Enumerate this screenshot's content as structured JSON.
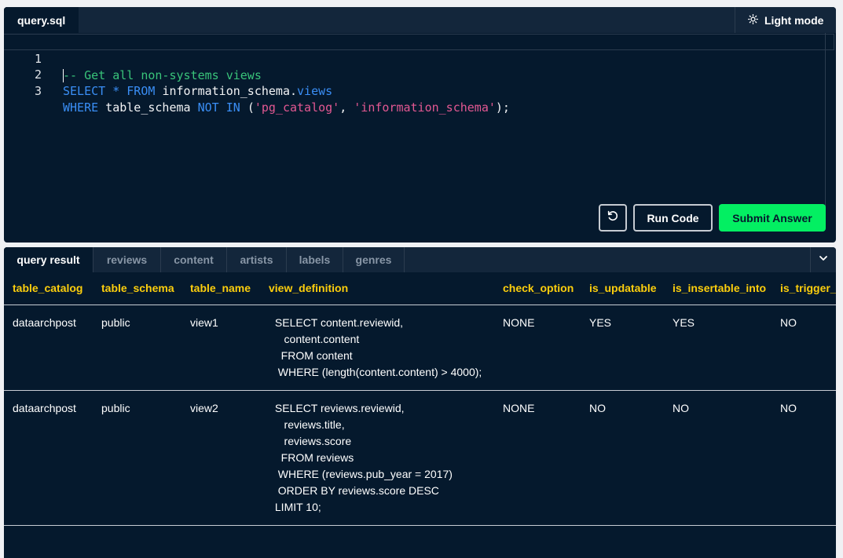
{
  "editor": {
    "file_tab": "query.sql",
    "mode_toggle_label": "Light mode",
    "line_numbers": [
      "1",
      "2",
      "3"
    ],
    "line1": {
      "comment": "-- Get all non-systems views"
    },
    "line2": {
      "kw_select": "SELECT",
      "op_star": "*",
      "kw_from": "FROM",
      "schema": "information_schema.",
      "view_prop": "views"
    },
    "line3": {
      "kw_where": "WHERE",
      "column": "table_schema",
      "kw_not": "NOT",
      "kw_in": "IN",
      "open_paren": "(",
      "str1": "'pg_catalog'",
      "comma": ",",
      "str2": "'information_schema'",
      "close": ");"
    },
    "buttons": {
      "reset_icon": "reset-icon",
      "run_label": "Run Code",
      "submit_label": "Submit Answer"
    }
  },
  "results": {
    "tabs": [
      "query result",
      "reviews",
      "content",
      "artists",
      "labels",
      "genres"
    ],
    "active_tab": "query result",
    "columns": [
      "table_catalog",
      "table_schema",
      "table_name",
      "view_definition",
      "check_option",
      "is_updatable",
      "is_insertable_into",
      "is_trigger_"
    ],
    "rows": [
      [
        "dataarchpost",
        "public",
        "view1",
        " SELECT content.reviewid,\n    content.content\n   FROM content\n  WHERE (length(content.content) > 4000);",
        "NONE",
        "YES",
        "YES",
        "NO"
      ],
      [
        "dataarchpost",
        "public",
        "view2",
        " SELECT reviews.reviewid,\n    reviews.title,\n    reviews.score\n   FROM reviews\n  WHERE (reviews.pub_year = 2017)\n  ORDER BY reviews.score DESC\n LIMIT 10;",
        "NONE",
        "NO",
        "NO",
        "NO"
      ]
    ]
  },
  "colors": {
    "background": "#05192d",
    "header_bar": "#13263b",
    "accent_green": "#03ef62",
    "column_header": "#fcce0d",
    "sql_keyword": "#3a8ef5",
    "sql_string": "#e35892",
    "sql_comment": "#39c47a"
  }
}
